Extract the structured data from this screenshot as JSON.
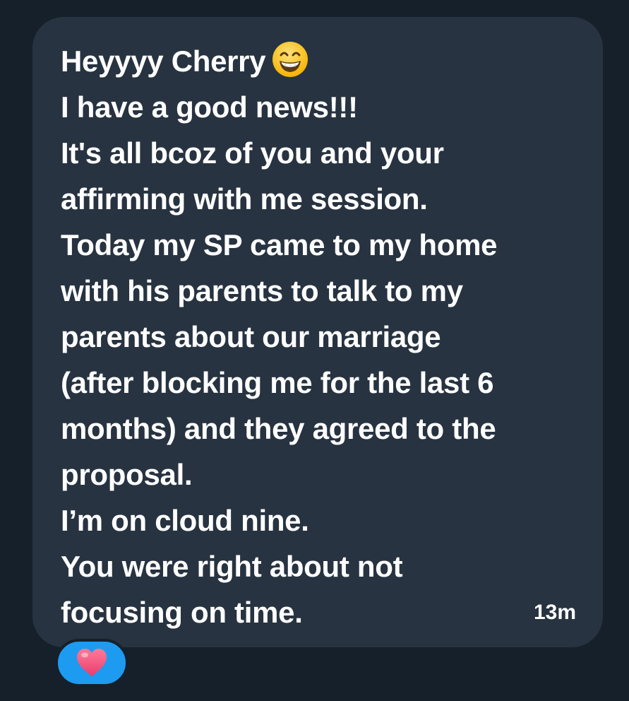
{
  "message": {
    "lines": [
      "Heyyyy Cherry",
      "I have a good news!!!",
      "It's all bcoz of you and your",
      "affirming with me session.",
      "Today my SP came to my home",
      "with his parents to talk to my",
      "parents about our marriage",
      "(after blocking me for the last 6",
      "months) and they agreed to the",
      "proposal.",
      "I’m on cloud nine.",
      "You were right about not",
      "focusing on time."
    ],
    "emoji": "grinning-face-with-smiling-eyes-icon",
    "timestamp": "13m"
  },
  "reaction": {
    "icon": "heart-icon",
    "accent_color": "#1d9bf0"
  },
  "colors": {
    "background": "#15202b",
    "bubble": "#273340",
    "text": "#ffffff"
  }
}
